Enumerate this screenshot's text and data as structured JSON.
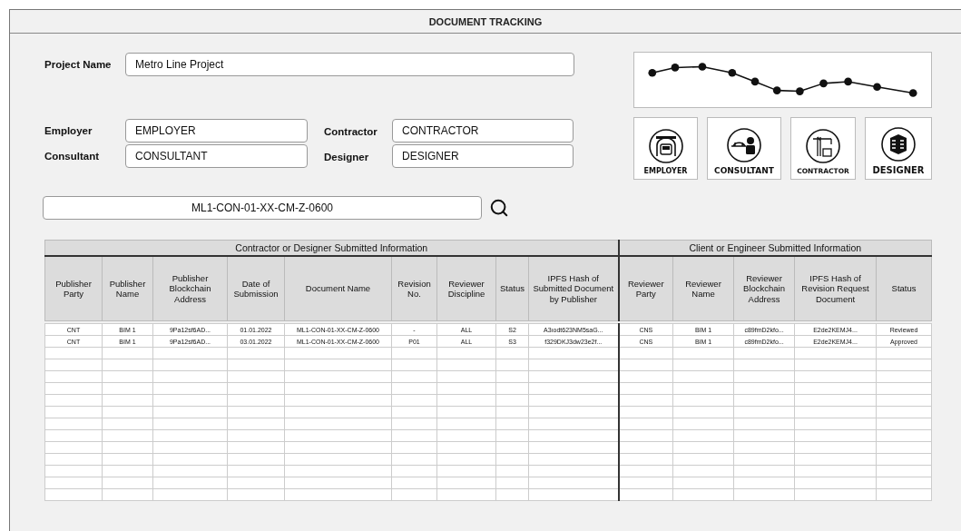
{
  "title": "DOCUMENT TRACKING",
  "project": {
    "label": "Project Name",
    "value": "Metro Line Project"
  },
  "parties": [
    {
      "label": "Employer",
      "value": "EMPLOYER"
    },
    {
      "label": "Contractor",
      "value": "CONTRACTOR"
    },
    {
      "label": "Consultant",
      "value": "CONSULTANT"
    },
    {
      "label": "Designer",
      "value": "DESIGNER"
    }
  ],
  "search": {
    "value": "ML1-CON-01-XX-CM-Z-0600"
  },
  "party_buttons": [
    {
      "kind": "tunnel",
      "label": "EMPLOYER"
    },
    {
      "kind": "bridge",
      "label": "CONSULTANT"
    },
    {
      "kind": "crane",
      "label": "CONTRACTOR"
    },
    {
      "kind": "building",
      "label": "DESIGNER"
    }
  ],
  "table": {
    "groups": [
      {
        "title": "Contractor or Designer Submitted Information",
        "columns": [
          "Publisher Party",
          "Publisher Name",
          "Publisher Blockchain Address",
          "Date of Submission",
          "Document Name",
          "Revision No.",
          "Reviewer Discipline",
          "Status",
          "IPFS Hash of Submitted Document by Publisher"
        ]
      },
      {
        "title": "Client or Engineer Submitted Information",
        "columns": [
          "Reviewer Party",
          "Reviewer Name",
          "Reviewer Blockchain Address",
          "IPFS Hash of Revision Request Document",
          "Status"
        ]
      }
    ],
    "rows": [
      [
        "CNT",
        "BIM 1",
        "9Pa12sf6AD...",
        "01.01.2022",
        "ML1-CON-01-XX-CM-Z-0600",
        "-",
        "ALL",
        "S2",
        "A3ıodt623NM5saG...",
        "CNS",
        "BIM 1",
        "c89fmD2kfo...",
        "E2de2KEMJ4...",
        "Reviewed"
      ],
      [
        "CNT",
        "BIM 1",
        "9Pa12sf6AD...",
        "03.01.2022",
        "ML1-CON-01-XX-CM-Z-0600",
        "P01",
        "ALL",
        "S3",
        "f329DKJ3dw23e2f...",
        "CNS",
        "BIM 1",
        "c89fmD2kfo...",
        "E2de2KEMJ4...",
        "Approved"
      ]
    ]
  }
}
